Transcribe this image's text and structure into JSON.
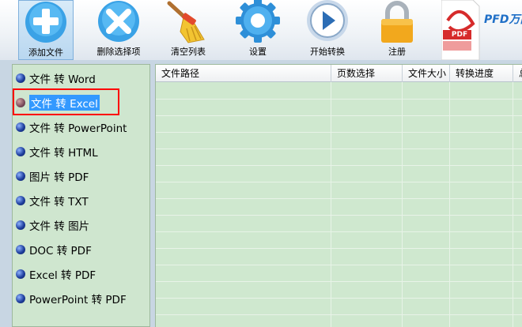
{
  "toolbar": {
    "add_file": "添加文件",
    "delete_selected": "删除选择项",
    "clear_list": "清空列表",
    "settings": "设置",
    "start_convert": "开始转换",
    "register": "注册",
    "brand_pdf": "PDF",
    "brand_text": "PFD万能"
  },
  "conversions": [
    "文件 转 Word",
    "文件 转 Excel",
    "文件 转 PowerPoint",
    "文件 转 HTML",
    "图片 转 PDF",
    "文件 转 TXT",
    "文件 转 图片",
    "DOC 转 PDF",
    "Excel 转 PDF",
    "PowerPoint 转 PDF"
  ],
  "table": {
    "columns": [
      "文件路径",
      "页数选择",
      "文件大小",
      "转换进度",
      "总"
    ]
  },
  "colors": {
    "panel_green": "#cfe6cf",
    "selection_blue": "#3399ff",
    "highlight_red": "#ff0000"
  }
}
